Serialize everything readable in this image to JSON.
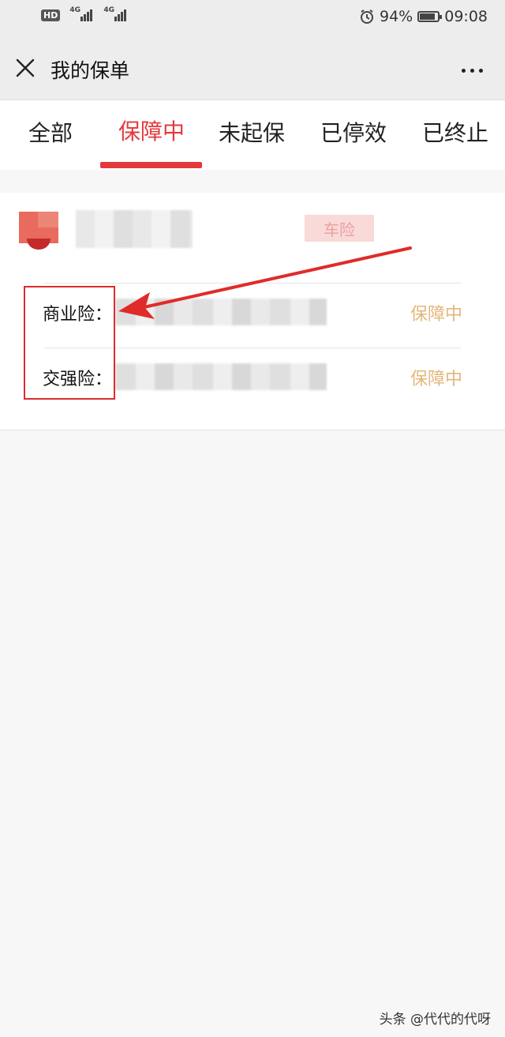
{
  "status_bar": {
    "hd": "HD",
    "sim1_network": "4G",
    "sim2_network": "4G",
    "battery_percent": "94%",
    "time": "09:08",
    "icons": [
      "alarm-icon",
      "battery-icon",
      "signal-icon"
    ]
  },
  "nav": {
    "title": "我的保单",
    "close_icon": "close-icon",
    "more_icon": "more-icon"
  },
  "tabs": [
    {
      "label": "全部",
      "active": false
    },
    {
      "label": "保障中",
      "active": true
    },
    {
      "label": "未起保",
      "active": false
    },
    {
      "label": "已停效",
      "active": false
    },
    {
      "label": "已终止",
      "active": false
    }
  ],
  "policy_card": {
    "type_tag": "车险",
    "rows": [
      {
        "label": "商业险：",
        "status": "保障中"
      },
      {
        "label": "交强险：",
        "status": "保障中"
      }
    ]
  },
  "colors": {
    "accent": "#e4393c",
    "status_text": "#e3b77a",
    "tag_bg": "#fad9d9",
    "annotation": "#e02b2b"
  },
  "watermark": "头条 @代代的代呀"
}
